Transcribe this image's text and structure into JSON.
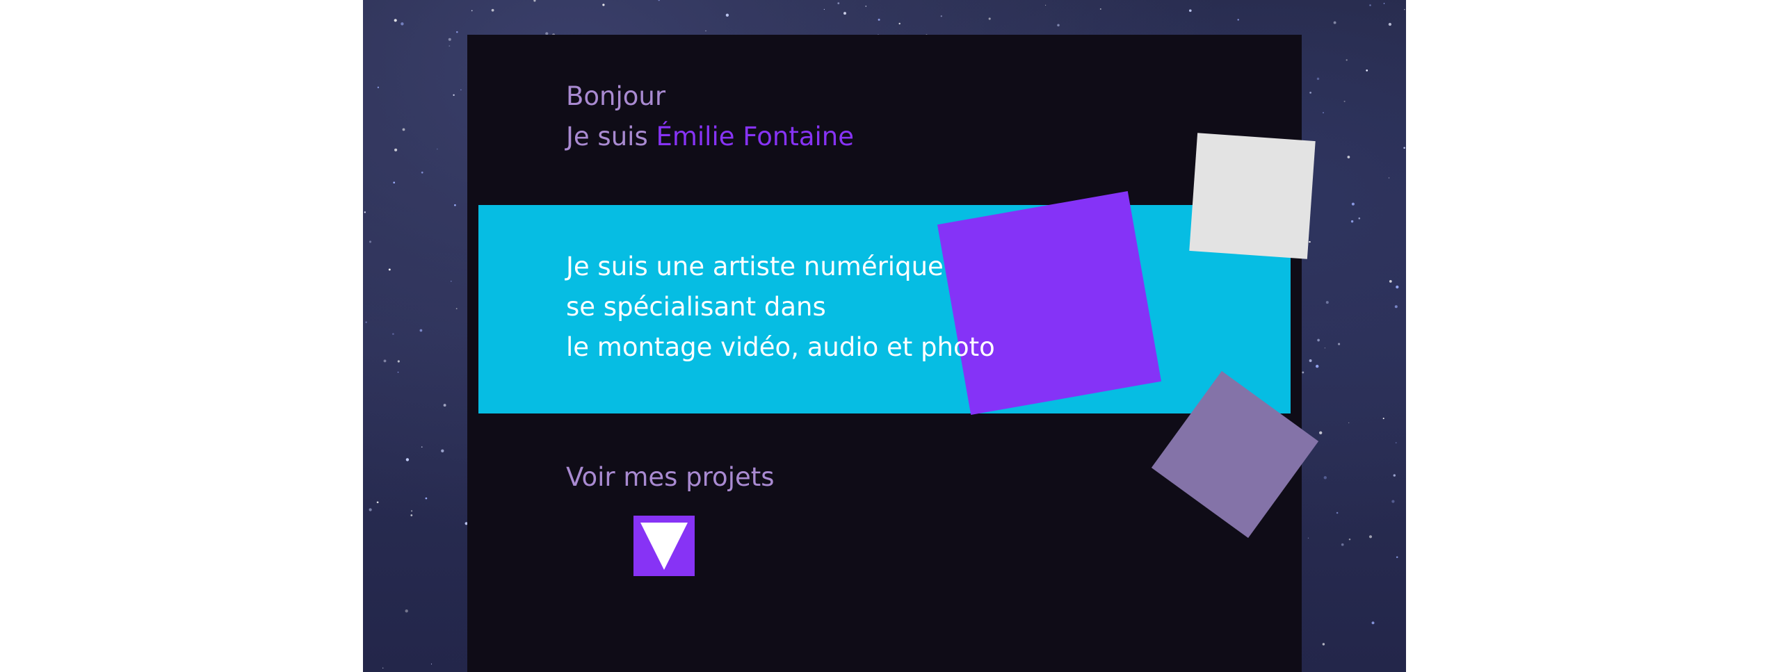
{
  "hero": {
    "greeting": "Bonjour",
    "intro_prefix": "Je suis ",
    "name": "Émilie Fontaine",
    "tagline": [
      "Je suis une artiste numérique",
      "se spécialisant dans",
      "le montage vidéo, audio et photo"
    ],
    "cta_label": "Voir mes projets",
    "cta_icon": "triangle-down-icon"
  },
  "colors": {
    "page_background": "#ffffff",
    "card_background": "#0f0c17",
    "accent_purple": "#8733f5",
    "muted_lavender_text": "#a98ad1",
    "band_cyan": "#06bde3",
    "square_grey": "#e3e3e3",
    "square_lavender": "#8473a8"
  }
}
